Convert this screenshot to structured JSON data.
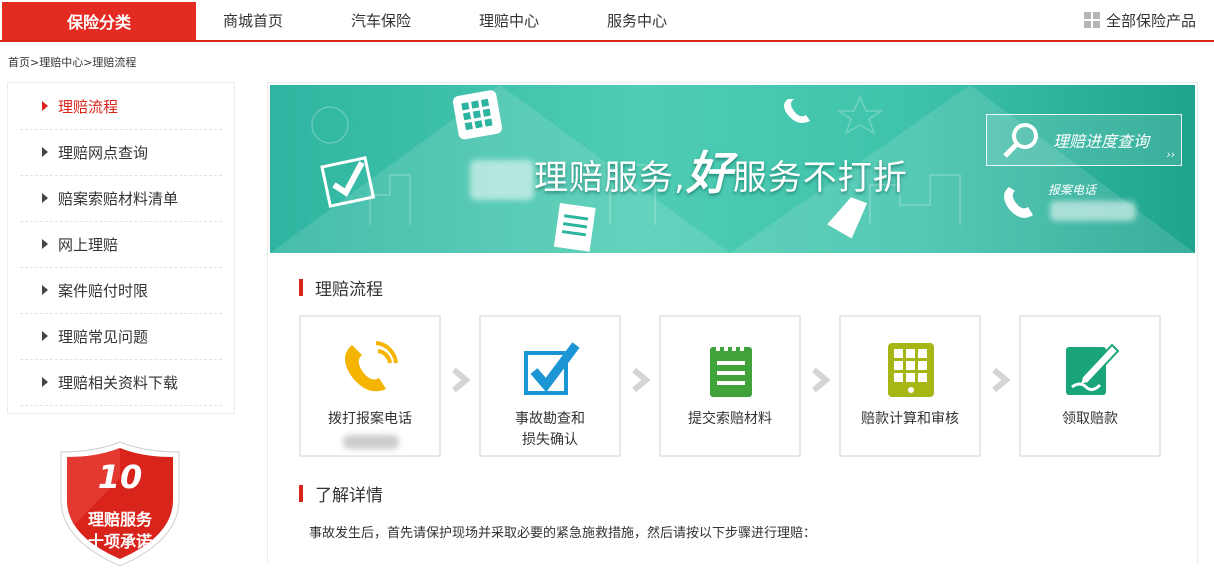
{
  "nav": {
    "category_button": "保险分类",
    "items": [
      "商城首页",
      "汽车保险",
      "理赔中心",
      "服务中心"
    ],
    "all_products": "全部保险产品"
  },
  "breadcrumb": "首页>理赔中心>理赔流程",
  "sidebar": {
    "items": [
      {
        "label": "理赔流程",
        "active": true
      },
      {
        "label": "理赔网点查询",
        "active": false
      },
      {
        "label": "赔案索赔材料清单",
        "active": false
      },
      {
        "label": "网上理赔",
        "active": false
      },
      {
        "label": "案件赔付时限",
        "active": false
      },
      {
        "label": "理赔常见问题",
        "active": false
      },
      {
        "label": "理赔相关资料下载",
        "active": false
      }
    ],
    "badge": {
      "number": "10",
      "line1": "理赔服务",
      "line2": "十项承诺"
    }
  },
  "banner": {
    "title_part1": "理赔服务,",
    "title_big": "好",
    "title_part2": "服务不打折",
    "progress_button": "理赔进度查询",
    "report_phone_label": "报案电话"
  },
  "process": {
    "title": "理赔流程",
    "steps": [
      {
        "line1": "拨打报案电话",
        "line2": "",
        "icon": "phone-icon"
      },
      {
        "line1": "事故勘查和",
        "line2": "损失确认",
        "icon": "checkbox-icon"
      },
      {
        "line1": "提交索赔材料",
        "line2": "",
        "icon": "document-icon"
      },
      {
        "line1": "赔款计算和审核",
        "line2": "",
        "icon": "calculator-icon"
      },
      {
        "line1": "领取赔款",
        "line2": "",
        "icon": "sign-icon"
      }
    ]
  },
  "details": {
    "title": "了解详情",
    "text": "事故发生后，首先请保护现场并采取必要的紧急施救措施，然后请按以下步骤进行理赔："
  },
  "colors": {
    "brand_red": "#e32b22",
    "teal": "#3ec2ab"
  }
}
